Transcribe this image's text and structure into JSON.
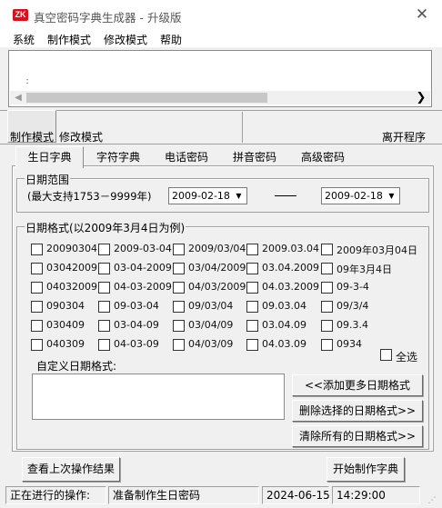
{
  "window": {
    "title": "真空密码字典生成器 - 升级版",
    "icon_text": "ZK",
    "close_symbol": "✕"
  },
  "menu": [
    "系统",
    "制作模式",
    "修改模式",
    "帮助"
  ],
  "log": {
    "text": "  :",
    "scroll_left": "◀",
    "scroll_right": "❯"
  },
  "toolbar": {
    "make_mode": "制作模式",
    "modify_mode": "修改模式",
    "exit": "离开程序"
  },
  "tabs": [
    "生日字典",
    "字符字典",
    "电话密码",
    "拼音密码",
    "高级密码"
  ],
  "date_range": {
    "group_title": "日期范围",
    "hint": "(最大支持1753－9999年)",
    "start": "2009-02-18",
    "end": "2009-02-18",
    "dropdown_arrow": "▼"
  },
  "date_format": {
    "group_title": "日期格式(以2009年3月4日为例)",
    "rows": [
      [
        "20090304",
        "2009-03-04",
        "2009/03/04",
        "2009.03.04",
        "2009年03月04日"
      ],
      [
        "03042009",
        "03-04-2009",
        "03/04/2009",
        "03.04.2009",
        "09年3月4日"
      ],
      [
        "04032009",
        "04-03-2009",
        "04/03/2009",
        "04.03.2009",
        "09-3-4"
      ],
      [
        "090304",
        "09-03-04",
        "09/03/04",
        "09.03.04",
        "09/3/4"
      ],
      [
        "030409",
        "03-04-09",
        "03/04/09",
        "03.04.09",
        "09.3.4"
      ],
      [
        "040309",
        "04-03-09",
        "04/03/09",
        "04.03.09",
        "0934"
      ]
    ],
    "select_all": "全选",
    "custom_label": "自定义日期格式:",
    "add_button": "<<添加更多日期格式",
    "delete_button": "删除选择的日期格式>>",
    "clear_button": "清除所有的日期格式>>"
  },
  "actions": {
    "view_last": "查看上次操作结果",
    "start": "开始制作字典"
  },
  "status": {
    "label": "正在进行的操作:",
    "message": "准备制作生日密码",
    "date": "2024-06-15",
    "time": "14:29:00"
  }
}
